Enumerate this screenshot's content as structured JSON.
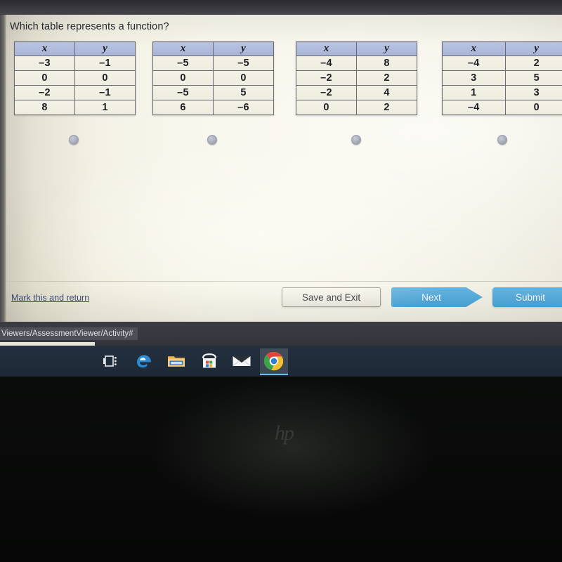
{
  "question": {
    "text": "Which table represents a function?"
  },
  "options": [
    {
      "id": "option-a",
      "headers": [
        "x",
        "y"
      ],
      "rows": [
        [
          "–3",
          "–1"
        ],
        [
          "0",
          "0"
        ],
        [
          "–2",
          "–1"
        ],
        [
          "8",
          "1"
        ]
      ],
      "selected": false
    },
    {
      "id": "option-b",
      "headers": [
        "x",
        "y"
      ],
      "rows": [
        [
          "–5",
          "–5"
        ],
        [
          "0",
          "0"
        ],
        [
          "–5",
          "5"
        ],
        [
          "6",
          "–6"
        ]
      ],
      "selected": false
    },
    {
      "id": "option-c",
      "headers": [
        "x",
        "y"
      ],
      "rows": [
        [
          "–4",
          "8"
        ],
        [
          "–2",
          "2"
        ],
        [
          "–2",
          "4"
        ],
        [
          "0",
          "2"
        ]
      ],
      "selected": false
    },
    {
      "id": "option-d",
      "headers": [
        "x",
        "y"
      ],
      "rows": [
        [
          "–4",
          "2"
        ],
        [
          "3",
          "5"
        ],
        [
          "1",
          "3"
        ],
        [
          "–4",
          "0"
        ]
      ],
      "selected": false
    }
  ],
  "footer": {
    "mark_link": "Mark this and return",
    "save_label": "Save and Exit",
    "next_label": "Next",
    "submit_label": "Submit"
  },
  "browser": {
    "status_url": "Viewers/AssessmentViewer/Activity#"
  },
  "taskbar": {
    "items": [
      {
        "name": "task-view-icon",
        "label": "Task View"
      },
      {
        "name": "edge-icon",
        "label": "Microsoft Edge"
      },
      {
        "name": "file-explorer-icon",
        "label": "File Explorer"
      },
      {
        "name": "microsoft-store-icon",
        "label": "Microsoft Store"
      },
      {
        "name": "mail-icon",
        "label": "Mail"
      },
      {
        "name": "chrome-icon",
        "label": "Google Chrome"
      }
    ],
    "active_index": 5
  },
  "device": {
    "brand_mark": "hp"
  },
  "colors": {
    "accent_blue": "#4ba4d6",
    "table_header": "#aebada",
    "page_bg": "#f2f0e4",
    "link": "#3c4b78"
  }
}
